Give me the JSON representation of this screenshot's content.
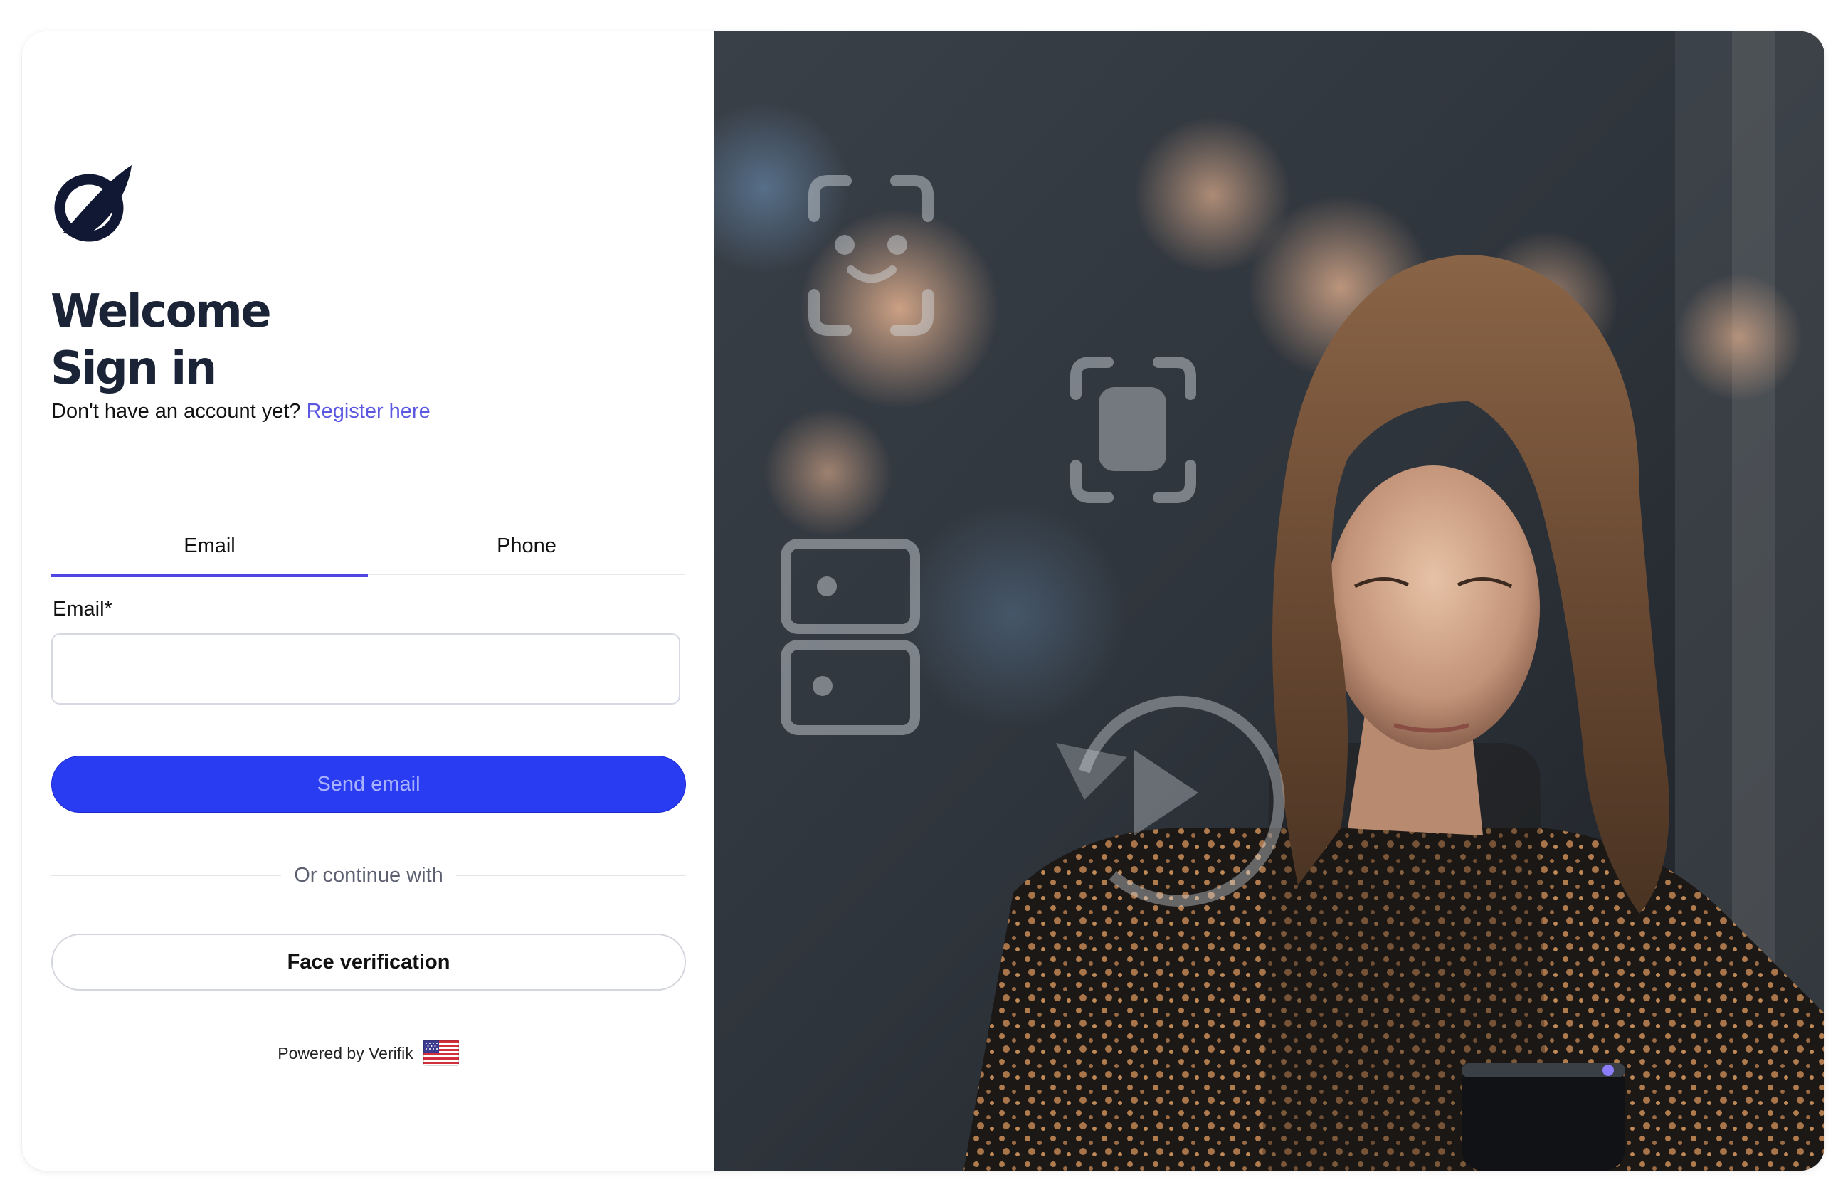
{
  "auth": {
    "title_line1": "Welcome",
    "title_line2": "Sign in",
    "no_account_text": "Don't have an account yet?",
    "register_link": "Register here"
  },
  "tabs": [
    {
      "label": "Email",
      "active": true
    },
    {
      "label": "Phone",
      "active": false
    }
  ],
  "email_form": {
    "label": "Email*",
    "value": "",
    "placeholder": "",
    "submit_label": "Send email"
  },
  "divider_text": "Or continue with",
  "face_verification_label": "Face verification",
  "footer": {
    "powered_by": "Powered by Verifik",
    "language_flag": "us-flag-icon"
  },
  "colors": {
    "accent": "#2a3cf2",
    "link": "#5b57e0",
    "tab_indicator": "#4f46e5",
    "heading": "#1b2436"
  },
  "icons": [
    "verifik-logo",
    "face-scan-icon",
    "face-frame-icon",
    "id-card-icon",
    "play-refresh-icon",
    "us-flag-icon"
  ]
}
